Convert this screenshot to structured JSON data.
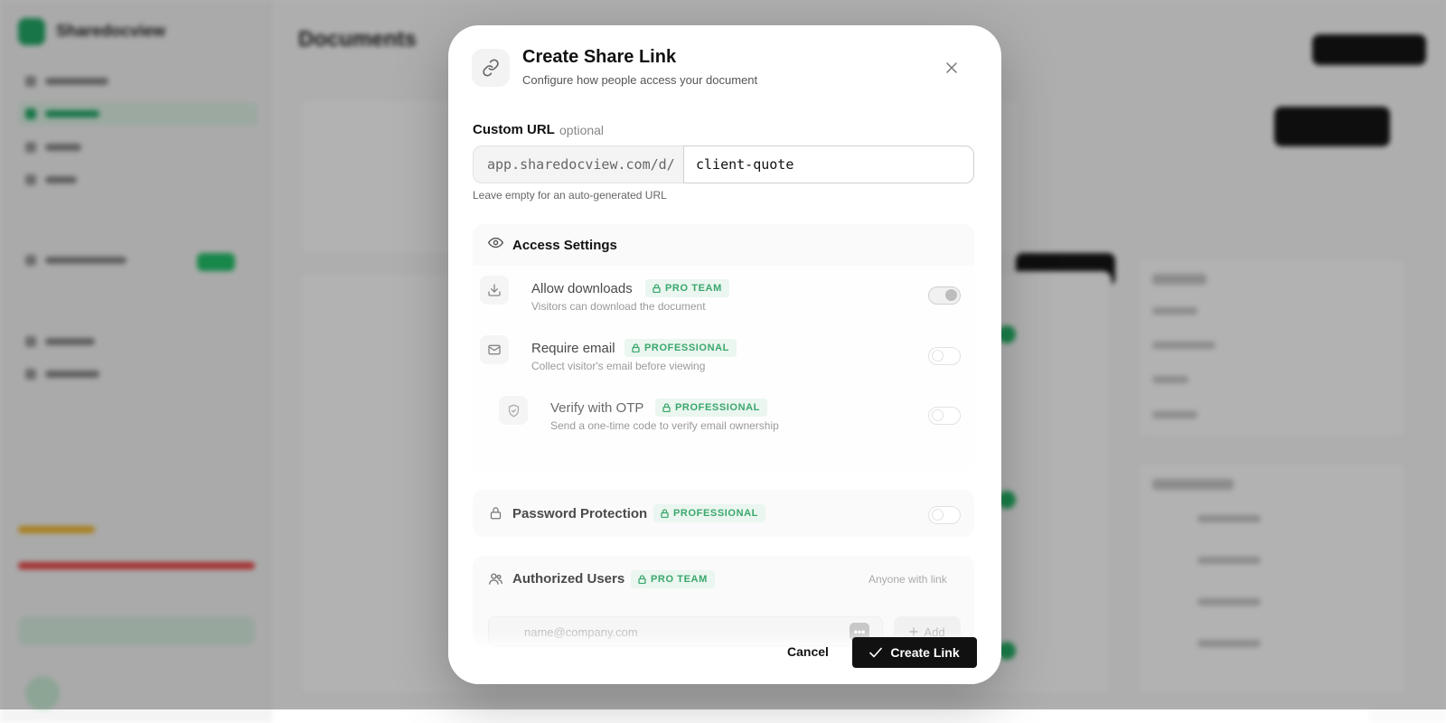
{
  "background": {
    "app_name": "Sharedocview",
    "page_title": "Documents"
  },
  "modal": {
    "title": "Create Share Link",
    "subtitle": "Configure how people access your document",
    "custom_url": {
      "label": "Custom URL",
      "optional": "optional",
      "prefix": "app.sharedocview.com/d/",
      "value": "client-quote",
      "hint": "Leave empty for an auto-generated URL"
    },
    "access_settings": {
      "title": "Access Settings",
      "allow_downloads": {
        "title": "Allow downloads",
        "badge": "PRO TEAM",
        "description": "Visitors can download the document",
        "enabled": true
      },
      "require_email": {
        "title": "Require email",
        "badge": "PROFESSIONAL",
        "description": "Collect visitor's email before viewing",
        "enabled": false
      },
      "verify_otp": {
        "title": "Verify with OTP",
        "badge": "PROFESSIONAL",
        "description": "Send a one-time code to verify email ownership",
        "enabled": false
      }
    },
    "password_protection": {
      "title": "Password Protection",
      "badge": "PROFESSIONAL",
      "enabled": false
    },
    "authorized_users": {
      "title": "Authorized Users",
      "badge": "PRO TEAM",
      "status": "Anyone with link",
      "placeholder": "name@company.com",
      "dots": "•••",
      "add_label": "Add"
    },
    "buttons": {
      "cancel": "Cancel",
      "create": "Create Link"
    }
  },
  "colors": {
    "accent_green": "#3aa76d",
    "badge_bg": "#eaf6ef",
    "primary_button": "#111111"
  },
  "icons": {
    "header": "link-icon",
    "close": "close-icon",
    "access": "eye-icon",
    "downloads": "download-icon",
    "email": "mail-icon",
    "otp": "shield-check-icon",
    "password": "lock-icon",
    "users": "users-icon",
    "create": "check-icon"
  }
}
